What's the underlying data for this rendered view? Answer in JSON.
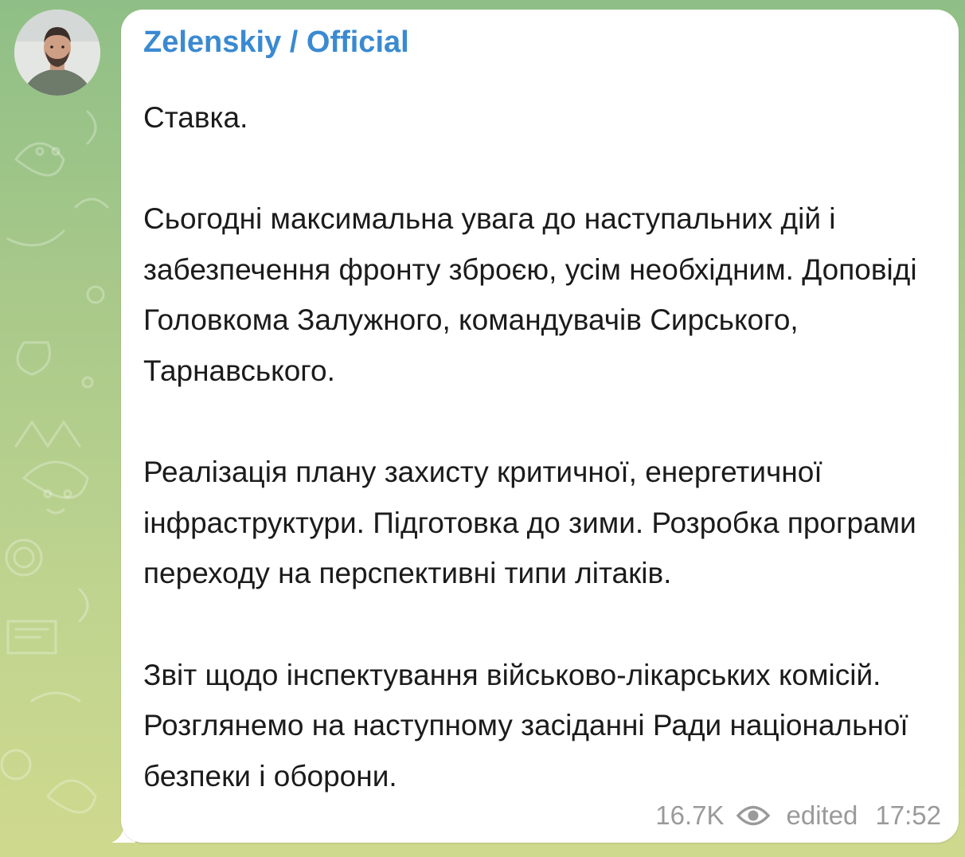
{
  "channel": {
    "name": "Zelenskiy / Official",
    "avatar_icon": "channel-avatar-portrait"
  },
  "message": {
    "paragraphs": [
      "Ставка.",
      "Сьогодні максимальна увага до наступальних дій і забезпечення фронту зброєю, усім необхідним. Доповіді Головкома Залужного, командувачів Сирського, Тарнавського.",
      "Реалізація плану захисту критичної, енергетичної інфраструктури. Підготовка до зими. Розробка програми переходу на перспективні типи літаків.",
      "Звіт щодо інспектування військово-лікарських комісій. Розглянемо на наступному засіданні Ради національної безпеки і оборони."
    ],
    "views": "16.7K",
    "views_icon": "eye-icon",
    "edited_label": "edited",
    "time": "17:52"
  },
  "colors": {
    "sender_name": "#3a8ad1",
    "bubble": "#ffffff",
    "meta_text": "#9a9a9a",
    "wallpaper": "#a9c98a"
  }
}
